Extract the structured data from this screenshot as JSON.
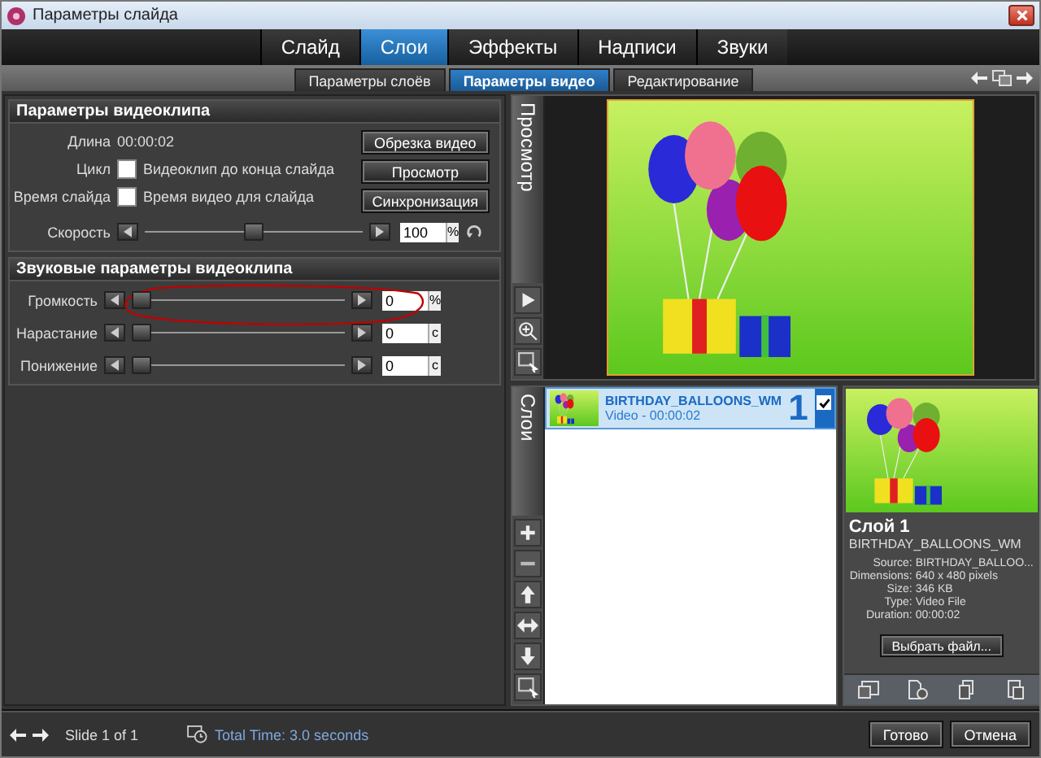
{
  "window": {
    "title": "Параметры слайда"
  },
  "tabs": [
    {
      "label": "Слайд",
      "selected": false
    },
    {
      "label": "Слои",
      "selected": true
    },
    {
      "label": "Эффекты",
      "selected": false
    },
    {
      "label": "Надписи",
      "selected": false
    },
    {
      "label": "Звуки",
      "selected": false
    }
  ],
  "subtabs": [
    {
      "label": "Параметры слоёв",
      "selected": false
    },
    {
      "label": "Параметры видео",
      "selected": true
    },
    {
      "label": "Редактирование",
      "selected": false
    }
  ],
  "video_params": {
    "title": "Параметры видеоклипа",
    "length_label": "Длина",
    "length_value": "00:00:02",
    "checks": [
      {
        "label": "Цикл",
        "text": "Видеоклип до конца слайда",
        "checked": false
      },
      {
        "label": "Время слайда",
        "text": "Время видео для слайда",
        "checked": false
      }
    ],
    "buttons": [
      "Обрезка видео",
      "Просмотр",
      "Синхронизация"
    ],
    "speed": {
      "label": "Скорость",
      "level": 0.5,
      "value": "100",
      "unit": "%"
    }
  },
  "audio_params": {
    "title": "Звуковые параметры видеоклипа",
    "sliders": [
      {
        "label": "Громкость",
        "level": 0,
        "value": "0",
        "unit": "%"
      },
      {
        "label": "Нарастание",
        "level": 0,
        "value": "0",
        "unit": "c"
      },
      {
        "label": "Понижение",
        "level": 0,
        "value": "0",
        "unit": "c"
      }
    ]
  },
  "preview": {
    "tab_label": "Просмотр"
  },
  "layers": {
    "tab_label": "Слои",
    "items": [
      {
        "name": "BIRTHDAY_BALLOONS_WM",
        "subtitle": "Video - 00:00:02",
        "number": "1",
        "checked": true,
        "selected": true
      }
    ]
  },
  "layer_info": {
    "title": "Слой 1",
    "filename": "BIRTHDAY_BALLOONS_WM",
    "fields": [
      {
        "label": "Source:",
        "value": "BIRTHDAY_BALLOO..."
      },
      {
        "label": "Dimensions:",
        "value": "640 x 480 pixels"
      },
      {
        "label": "Size:",
        "value": "346 KB"
      },
      {
        "label": "Type:",
        "value": "Video File"
      },
      {
        "label": "Duration:",
        "value": "00:00:02"
      }
    ],
    "button": "Выбрать файл..."
  },
  "status_bar": {
    "slide": "Slide 1 of 1",
    "total_time": "Total Time: 3.0 seconds",
    "buttons": [
      "Готово",
      "Отмена"
    ]
  }
}
